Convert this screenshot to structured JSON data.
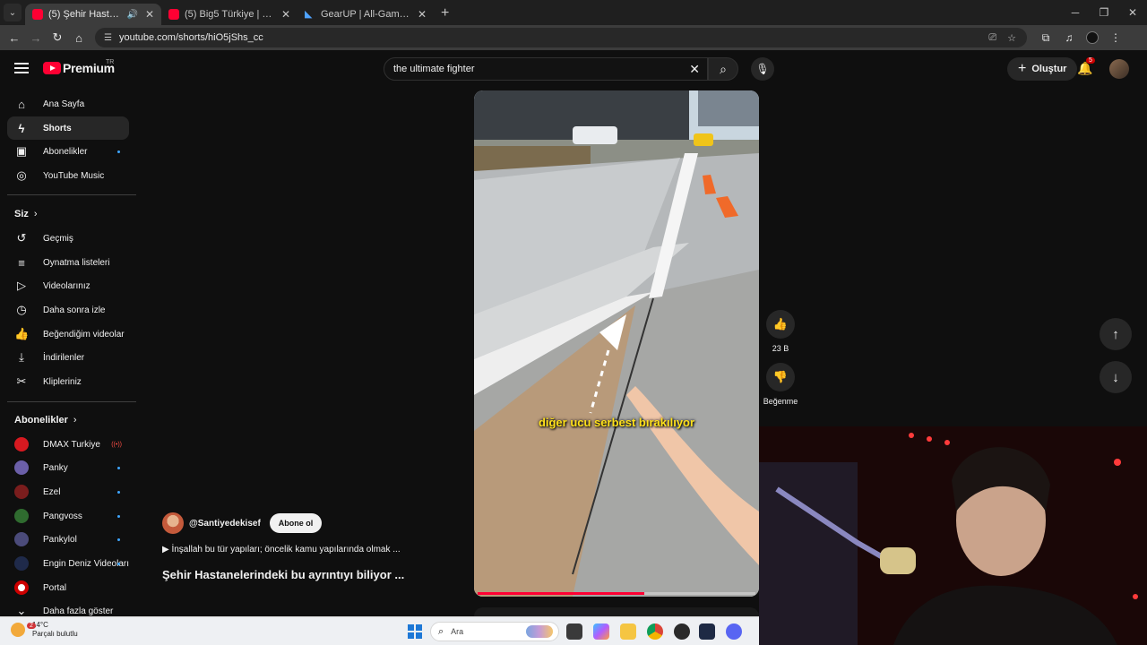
{
  "browser": {
    "tabs": [
      {
        "title": "(5) Şehir Hastanelerindeki bu",
        "active": true,
        "audio": true
      },
      {
        "title": "(5) Big5 Türkiye | Hazırlık Sezon",
        "active": false,
        "audio": false
      },
      {
        "title": "GearUP | All-Game Booster | Re",
        "active": false,
        "audio": false
      }
    ],
    "url": "youtube.com/shorts/hiO5jShs_cc"
  },
  "masthead": {
    "logo_text": "Premium",
    "country": "TR",
    "search_value": "the ultimate fighter",
    "create_label": "Oluştur",
    "notification_count": "5"
  },
  "sidebar": {
    "main": [
      {
        "label": "Ana Sayfa",
        "icon": "home-icon"
      },
      {
        "label": "Shorts",
        "icon": "shorts-icon"
      },
      {
        "label": "Abonelikler",
        "icon": "subscriptions-icon"
      },
      {
        "label": "YouTube Music",
        "icon": "music-icon"
      }
    ],
    "you_header": "Siz",
    "you": [
      {
        "label": "Geçmiş",
        "icon": "history-icon"
      },
      {
        "label": "Oynatma listeleri",
        "icon": "playlists-icon"
      },
      {
        "label": "Videolarınız",
        "icon": "your-videos-icon"
      },
      {
        "label": "Daha sonra izle",
        "icon": "watch-later-icon"
      },
      {
        "label": "Beğendiğim videolar",
        "icon": "liked-icon"
      },
      {
        "label": "İndirilenler",
        "icon": "downloads-icon"
      },
      {
        "label": "Klipleriniz",
        "icon": "clips-icon"
      }
    ],
    "subs_header": "Abonelikler",
    "subscriptions": [
      {
        "label": "DMAX Turkiye",
        "color": "#d71920"
      },
      {
        "label": "Panky",
        "color": "#6b5fa8"
      },
      {
        "label": "Ezel",
        "color": "#7a1d1d"
      },
      {
        "label": "Pangvoss",
        "color": "#2f6b2f"
      },
      {
        "label": "Pankylol",
        "color": "#4b4b7a"
      },
      {
        "label": "Engin Deniz Videoları",
        "color": "#1f2a4a"
      },
      {
        "label": "Portal",
        "color": "#cc0000"
      }
    ],
    "show_more": "Daha fazla göster"
  },
  "short": {
    "caption": "diğer ucu serbest bırakılıyor",
    "channel": "@Santiyedekisef",
    "subscribe_label": "Abone ol",
    "description": "İnşallah bu tür yapıları; öncelik kamu yapılarında olmak ...",
    "title": "Şehir Hastanelerindeki bu ayrıntıyı biliyor ...",
    "likes": "23 B",
    "dislike_label": "Beğenme",
    "progress": 0.6
  },
  "taskbar": {
    "temp": "14°C",
    "weather": "Parçalı bulutlu",
    "weather_badge": "2",
    "search_placeholder": "Ara"
  },
  "colors": {
    "accent": "#ff0033",
    "caption": "#ffe11a",
    "link": "#3ea6ff"
  }
}
